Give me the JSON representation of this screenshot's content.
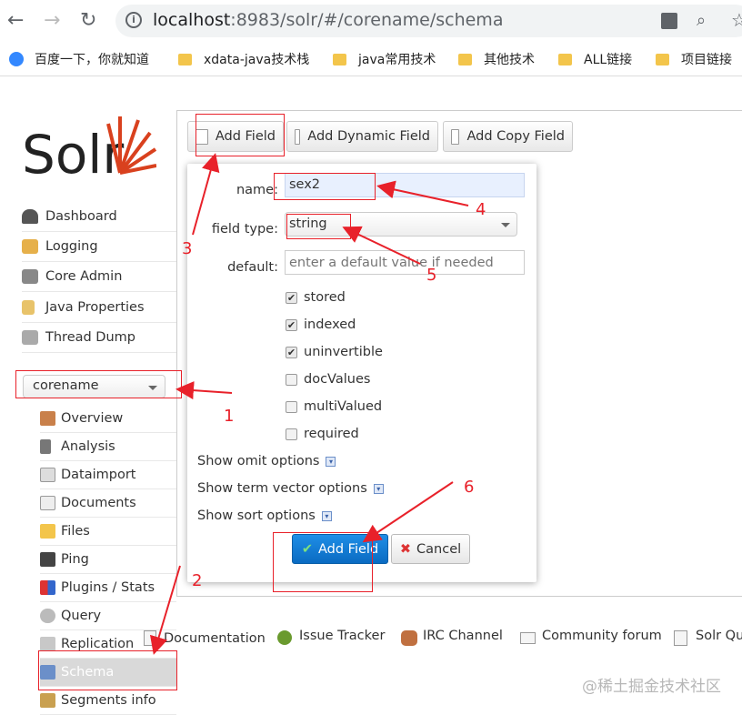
{
  "browser": {
    "url_host": "localhost",
    "url_rest": ":8983/solr/#/corename/schema",
    "bookmarks": [
      "百度一下，你就知道",
      "xdata-java技术栈",
      "java常用技术",
      "其他技术",
      "ALL链接",
      "项目链接"
    ]
  },
  "sidebar": {
    "logo_text": "Solr",
    "items": [
      "Dashboard",
      "Logging",
      "Core Admin",
      "Java Properties",
      "Thread Dump"
    ],
    "core_selector": "corename",
    "core_items": [
      "Overview",
      "Analysis",
      "Dataimport",
      "Documents",
      "Files",
      "Ping",
      "Plugins / Stats",
      "Query",
      "Replication",
      "Schema",
      "Segments info"
    ]
  },
  "toolbar": {
    "add_field": "Add Field",
    "add_dynamic_field": "Add Dynamic Field",
    "add_copy_field": "Add Copy Field"
  },
  "dialog": {
    "name_label": "name:",
    "name_value": "sex2",
    "type_label": "field type:",
    "type_value": "string",
    "default_label": "default:",
    "default_placeholder": "enter a default value if needed",
    "checkboxes": [
      {
        "label": "stored",
        "checked": true
      },
      {
        "label": "indexed",
        "checked": true
      },
      {
        "label": "uninvertible",
        "checked": true
      },
      {
        "label": "docValues",
        "checked": false
      },
      {
        "label": "multiValued",
        "checked": false
      },
      {
        "label": "required",
        "checked": false
      }
    ],
    "options": [
      "Show omit options",
      "Show term vector options",
      "Show sort options"
    ],
    "submit": "Add Field",
    "cancel": "Cancel"
  },
  "footer": [
    "Documentation",
    "Issue Tracker",
    "IRC Channel",
    "Community forum",
    "Solr Qu"
  ],
  "annotations": [
    "1",
    "2",
    "3",
    "4",
    "5",
    "6"
  ],
  "watermark": "@稀土掘金技术社区",
  "colors": {
    "annotation": "#e8212a",
    "primary_button": "#0a6bc2"
  }
}
